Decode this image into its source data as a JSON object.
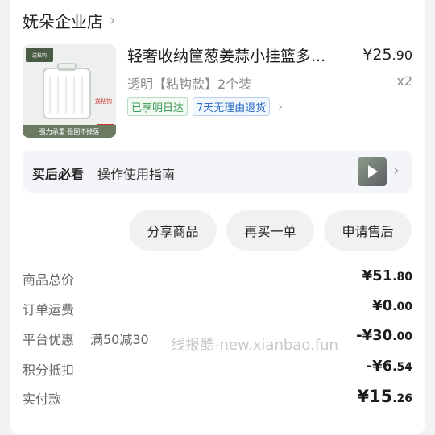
{
  "shop": {
    "name": "妩朵企业店"
  },
  "product": {
    "title": "轻奢收纳筐葱姜蒜小挂篮多...",
    "price_int": "¥25",
    "price_dec": ".90",
    "spec": "透明【粘钩款】2个装",
    "qty": "x2",
    "tags": [
      "已享明日达",
      "7天无理由退货"
    ],
    "image_texts": {
      "badge": "送粘钩",
      "gift": "送粘钩",
      "bar": "强力承重·稳固不掉落"
    }
  },
  "guide": {
    "label": "买后必看",
    "text": "操作使用指南"
  },
  "actions": [
    "分享商品",
    "再买一单",
    "申请售后"
  ],
  "summary": [
    {
      "label": "商品总价",
      "sub": "",
      "int": "¥51",
      "dec": ".80"
    },
    {
      "label": "订单运费",
      "sub": "",
      "int": "¥0",
      "dec": ".00"
    },
    {
      "label": "平台优惠",
      "sub": "满50减30",
      "int": "-¥30",
      "dec": ".00"
    },
    {
      "label": "积分抵扣",
      "sub": "",
      "int": "-¥6",
      "dec": ".54"
    },
    {
      "label": "实付款",
      "sub": "",
      "int": "¥15",
      "dec": ".26"
    }
  ],
  "watermark": "线报酷-new.xianbao.fun",
  "colors": {
    "tag_green": "#3b9b52",
    "tag_blue": "#2e6fc7",
    "page_bg": "#f2f2f2"
  }
}
